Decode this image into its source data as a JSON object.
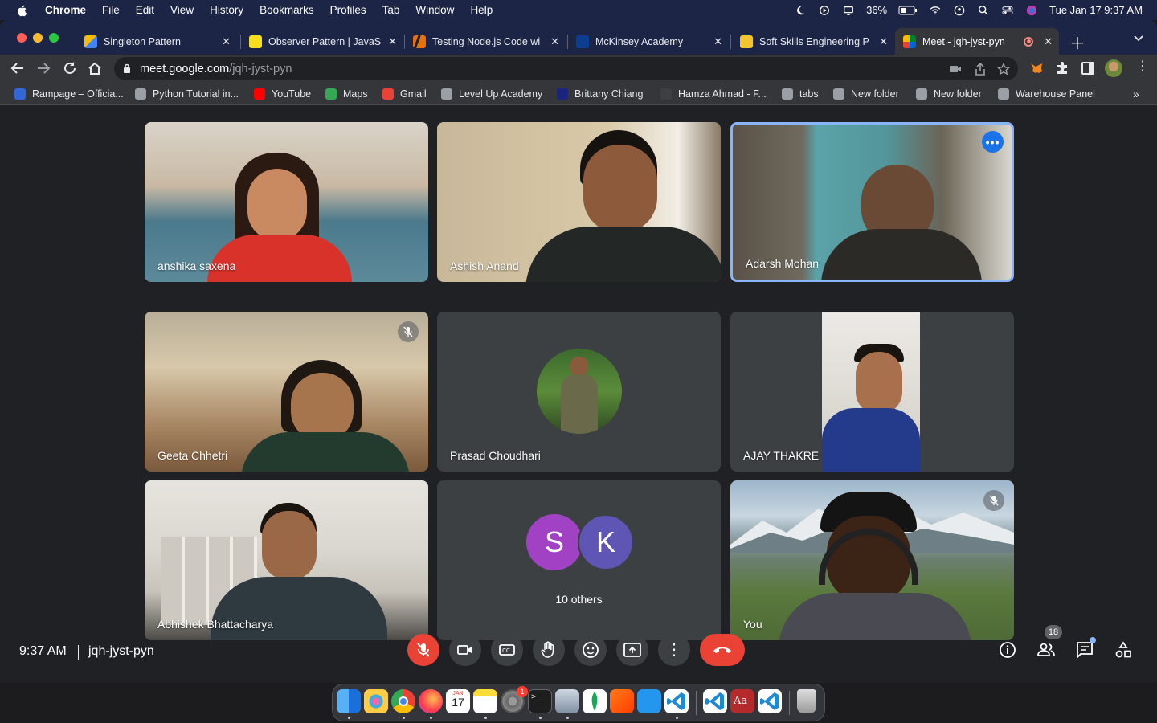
{
  "menubar": {
    "app": "Chrome",
    "items": [
      "File",
      "Edit",
      "View",
      "History",
      "Bookmarks",
      "Profiles",
      "Tab",
      "Window",
      "Help"
    ],
    "battery": "36%",
    "datetime": "Tue Jan 17  9:37 AM"
  },
  "tabs": [
    {
      "title": "Singleton Pattern",
      "color": "#4285f4"
    },
    {
      "title": "Observer Pattern | JavaS",
      "color": "#f7df1e"
    },
    {
      "title": "Testing Node.js Code wi",
      "color": "#e8710a"
    },
    {
      "title": "McKinsey Academy",
      "color": "#0b3d91"
    },
    {
      "title": "Soft Skills Engineering P",
      "color": "#f4c430"
    },
    {
      "title": "Meet - jqh-jyst-pyn",
      "color": "#00832d"
    }
  ],
  "address": {
    "host": "meet.google.com",
    "path": "/jqh-jyst-pyn"
  },
  "bookmarks": [
    {
      "label": "Rampage – Officia...",
      "color": "#3367d6"
    },
    {
      "label": "Python Tutorial in...",
      "color": "#9aa0a6"
    },
    {
      "label": "YouTube",
      "color": "#ff0000"
    },
    {
      "label": "Maps",
      "color": "#34a853"
    },
    {
      "label": "Gmail",
      "color": "#ea4335"
    },
    {
      "label": "Level Up Academy",
      "color": "#9aa0a6"
    },
    {
      "label": "Brittany Chiang",
      "color": "#1a237e"
    },
    {
      "label": "Hamza Ahmad - F...",
      "color": "#3c4043"
    },
    {
      "label": "tabs",
      "color": "#9aa0a6"
    },
    {
      "label": "New folder",
      "color": "#9aa0a6"
    },
    {
      "label": "New folder",
      "color": "#9aa0a6"
    },
    {
      "label": "Warehouse Panel",
      "color": "#9aa0a6"
    }
  ],
  "participants": [
    {
      "name": "anshika saxena",
      "bg": "#b88a6a",
      "muted": false
    },
    {
      "name": "Ashish Anand",
      "bg": "#6b5a48",
      "muted": false
    },
    {
      "name": "Adarsh Mohan",
      "bg": "#5a4e44",
      "muted": false
    },
    {
      "name": "Geeta Chhetri",
      "bg": "#a58a6b",
      "muted": true
    },
    {
      "name": "Prasad Choudhari",
      "bg": "#3c4043",
      "muted": false
    },
    {
      "name": "AJAY THAKRE",
      "bg": "#3c4043",
      "muted": false
    },
    {
      "name": "Abhishek Bhattacharya",
      "bg": "#9a9082",
      "muted": false
    },
    {
      "name": "10 others",
      "bg": "#3c4043",
      "muted": false
    },
    {
      "name": "You",
      "bg": "#7d8c78",
      "muted": true
    }
  ],
  "others": {
    "avatars": [
      {
        "letter": "S",
        "color": "#a142c4"
      },
      {
        "letter": "K",
        "color": "#5e55b5"
      }
    ],
    "label": "10 others"
  },
  "meeting": {
    "time": "9:37 AM",
    "code": "jqh-jyst-pyn",
    "people_count": "18"
  },
  "dock": {
    "calendar_month": "JAN",
    "calendar_day": "17",
    "badge": "1"
  },
  "colors": {
    "accent": "#8ab4f8",
    "leave": "#ea4335",
    "mute": "#ea4335"
  }
}
